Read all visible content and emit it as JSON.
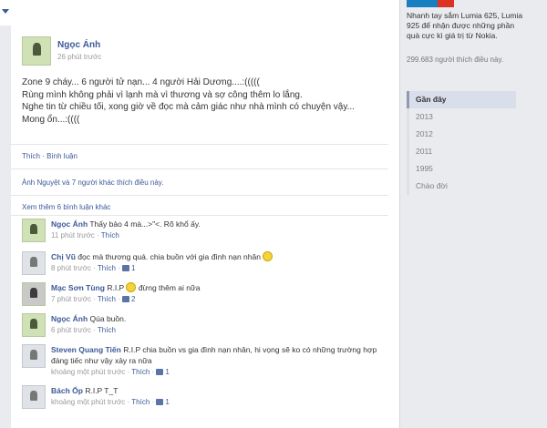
{
  "post": {
    "author": "Ngọc Ánh",
    "time": "26 phút trước",
    "body": [
      "Zone 9 cháy... 6 người tử nạn... 4 người Hải Dương....:(((((",
      "Rùng mình không phải vì lạnh mà vì thương và sợ công thêm lo lắng.",
      "Nghe tin từ chiều tối, xong giờ về đọc mà cảm giác như nhà mình có chuyện vậy...",
      "Mong ổn...:(((("
    ],
    "actions": "Thích · Bình luận",
    "likes": "Ánh Nguyệt và 7 người khác thích điều này.",
    "more_comments": "Xem thêm 6 bình luận khác"
  },
  "comments": [
    {
      "name": "Ngọc Ánh",
      "text": "Thấy bảo 4 mà...>\"<. Rõ khổ ấy.",
      "time": "11 phút trước",
      "like_label": "Thích",
      "like_count": ""
    },
    {
      "name": "Chị Vũ",
      "text": "đọc mà thương quá. chia buồn với gia đình nạn nhân",
      "time": "8 phút trước",
      "like_label": "Thích",
      "like_count": "1"
    },
    {
      "name": "Mạc Sơn Tùng",
      "text": "R.I.P",
      "text2": "đừng thêm ai nữa",
      "time": "7 phút trước",
      "like_label": "Thích",
      "like_count": "2"
    },
    {
      "name": "Ngọc Ánh",
      "text": "Qúa buồn.",
      "time": "6 phút trước",
      "like_label": "Thích",
      "like_count": ""
    },
    {
      "name": "Steven Quang Tiến",
      "text": "R.I.P chia buồn vs gia đình nạn nhân, hi vọng sẽ ko có những trường hợp đáng tiếc như vậy xảy ra nữa",
      "time": "khoảng một phút trước",
      "like_label": "Thích",
      "like_count": "1"
    },
    {
      "name": "Bách Ốp",
      "text": "R.I.P T_T",
      "time": "khoảng một phút trước",
      "like_label": "Thích",
      "like_count": "1"
    }
  ],
  "ad": {
    "text": "Nhanh tay sắm Lumia 625, Lumia 925 để nhận được những phần quà cực kì giá trị từ Nokia.",
    "likes": "299.683 người thích điều này."
  },
  "timeline": [
    "Gần đây",
    "2013",
    "2012",
    "2011",
    "1995",
    "Chào đời"
  ]
}
